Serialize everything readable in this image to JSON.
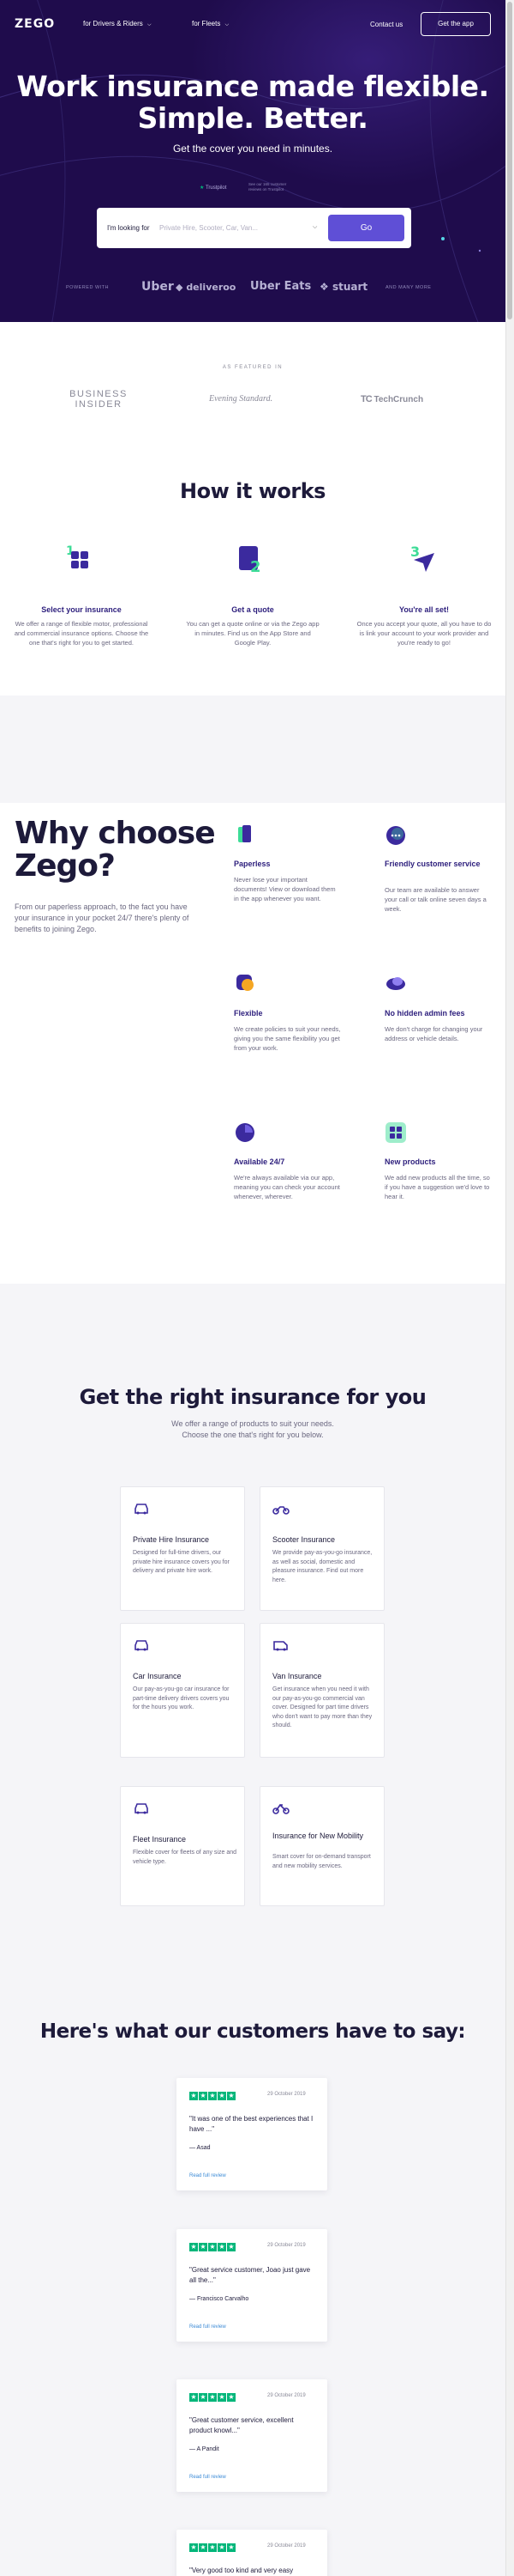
{
  "header": {
    "logo": "ZEGO",
    "nav": [
      {
        "label": "for Drivers & Riders"
      },
      {
        "label": "for Fleets"
      }
    ],
    "contact": "Contact us",
    "get_app": "Get the app"
  },
  "hero": {
    "title_line1": "Work insurance made flexible.",
    "title_line2": "Simple. Better.",
    "subtitle": "Get the cover you need in minutes.",
    "trustpilot": "Trustpilot",
    "trust_note": "See our 165 customer reviews on Trustpilot",
    "search_label": "I'm looking for",
    "search_placeholder": "Private Hire, Scooter, Car, Van...",
    "go_button": "Go",
    "powered_by": "POWERED WITH",
    "partners": [
      "Uber",
      "deliveroo",
      "Uber Eats",
      "stuart"
    ],
    "and_many_more": "AND MANY MORE"
  },
  "featured": {
    "label": "AS FEATURED IN",
    "press": [
      "BUSINESS INSIDER",
      "Evening Standard.",
      "TechCrunch"
    ]
  },
  "how_it_works": {
    "title": "How it works",
    "steps": [
      {
        "number": "1",
        "title": "Select your insurance",
        "text": "We offer a range of flexible motor, professional and commercial insurance options. Choose the one that's right for you to get started."
      },
      {
        "number": "2",
        "title": "Get a quote",
        "text": "You can get a quote online or via the Zego app in minutes. Find us on the App Store and Google Play."
      },
      {
        "number": "3",
        "title": "You're all set!",
        "text": "Once you accept your quote, all you have to do is link your account to your work provider and you're ready to go!"
      }
    ]
  },
  "why_choose": {
    "title_line1": "Why choose",
    "title_line2": "Zego?",
    "text": "From our paperless approach, to the fact you have your insurance in your pocket 24/7 there's plenty of benefits to joining Zego.",
    "benefits": [
      {
        "title": "Paperless",
        "text": "Never lose your important documents! View or download them in the app whenever you want."
      },
      {
        "title": "Friendly customer service",
        "text": "Our team are available to answer your call or talk online seven days a week."
      },
      {
        "title": "Flexible",
        "text": "We create policies to suit your needs, giving you the same flexibility you get from your work."
      },
      {
        "title": "No hidden admin fees",
        "text": "We don't charge for changing your address or vehicle details."
      },
      {
        "title": "Available 24/7",
        "text": "We're always available via our app, meaning you can check your account whenever, wherever."
      },
      {
        "title": "New products",
        "text": "We add new products all the time, so if you have a suggestion we'd love to hear it."
      }
    ]
  },
  "products": {
    "title": "Get the right insurance for you",
    "subtitle_line1": "We offer a range of products to suit your needs.",
    "subtitle_line2": "Choose the one that's right for you below.",
    "items": [
      {
        "title": "Private Hire Insurance",
        "text": "Designed for full-time drivers, our private hire insurance covers you for delivery and private hire work.",
        "icon": "car-icon"
      },
      {
        "title": "Scooter Insurance",
        "text": "We provide pay-as-you-go insurance, as well as social, domestic and pleasure insurance. Find out more here.",
        "icon": "scooter-icon"
      },
      {
        "title": "Car Insurance",
        "text": "Our pay-as-you-go car insurance for part-time delivery drivers covers you for the hours you work.",
        "icon": "car-icon"
      },
      {
        "title": "Van Insurance",
        "text": "Get insurance when you need it with our pay-as-you-go commercial van cover. Designed for part time drivers who don't want to pay more than they should.",
        "icon": "van-icon"
      },
      {
        "title": "Fleet Insurance",
        "text": "Flexible cover for fleets of any size and vehicle type.",
        "icon": "car-icon"
      },
      {
        "title": "Insurance for New Mobility",
        "text": "Smart cover for on-demand transport and new mobility services.",
        "icon": "bike-icon"
      }
    ]
  },
  "testimonials": {
    "title": "Here's what our customers have to say:",
    "reviews": [
      {
        "rating": 5,
        "date": "29 October 2019",
        "text": "\"It was one of the best experiences that I have ...\"",
        "author": "— Asad",
        "link": "Read full review"
      },
      {
        "rating": 5,
        "date": "29 October 2019",
        "text": "\"Great service customer, Joao just gave all the...\"",
        "author": "— Francisco Carvalho",
        "link": "Read full review"
      },
      {
        "rating": 5,
        "date": "29 October 2019",
        "text": "\"Great customer service, excellent product knowl...\"",
        "author": "— A Pandit",
        "link": "Read full review"
      },
      {
        "rating": 5,
        "date": "29 October 2019",
        "text": "\"Very good too kind and very easy"
      }
    ]
  },
  "colors": {
    "hero_bg": "#1f0c4c",
    "accent": "#5f4fd6",
    "heading_accent": "#2c1e7c",
    "trustpilot_green": "#00b67a",
    "icon_green": "#3ddc97"
  }
}
